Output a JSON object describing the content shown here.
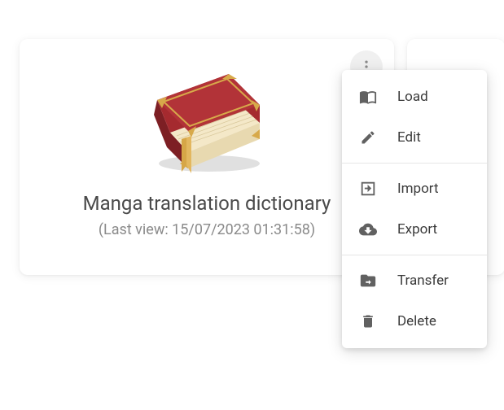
{
  "card": {
    "title": "Manga translation dictionary",
    "subtitle": "(Last view: 15/07/2023 01:31:58)"
  },
  "menu": {
    "items": [
      {
        "label": "Load"
      },
      {
        "label": "Edit"
      },
      {
        "label": "Import"
      },
      {
        "label": "Export"
      },
      {
        "label": "Transfer"
      },
      {
        "label": "Delete"
      }
    ]
  },
  "colors": {
    "icon": "#616161",
    "text": "#3a3a3a",
    "muted": "#8a8a8a"
  }
}
